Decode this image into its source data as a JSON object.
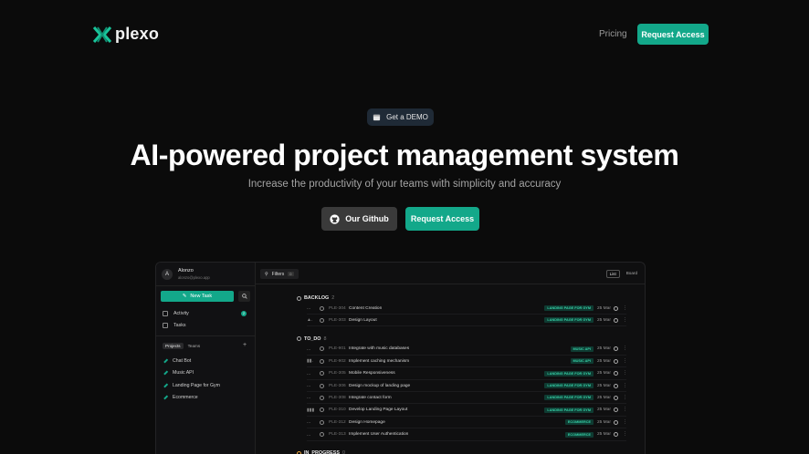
{
  "nav": {
    "brand": "plexo",
    "links": [
      "Pricing"
    ],
    "cta_label": "Request Access",
    "accent_color": "#13a88a"
  },
  "hero": {
    "demo_pill": "Get a DEMO",
    "title": "AI-powered project management system",
    "subtitle": "Increase the productivity of your teams with simplicity and accuracy",
    "github_label": "Our Github",
    "request_label": "Request Access"
  },
  "app": {
    "user": {
      "initial": "A",
      "name": "Alonzo",
      "email": "alonzo@plexo.app"
    },
    "new_task_label": "New Task",
    "nav": [
      {
        "label": "Activity",
        "badge": "2"
      },
      {
        "label": "Tasks"
      }
    ],
    "sidebar_tabs": [
      "Projects",
      "Teams"
    ],
    "projects": [
      "Chat Bot",
      "Music API",
      "Landing Page for Gym",
      "Ecommerce"
    ],
    "toolbar": {
      "filters_label": "Filters",
      "filters_count": "0",
      "view_list": "List",
      "view_board": "Board"
    },
    "groups": [
      {
        "name": "BACKLOG",
        "count": "2",
        "tasks": [
          {
            "priority": "...",
            "id": "PLE-304",
            "title": "Content Creation",
            "tag": "LANDING PAGE FOR GYM",
            "date": "25 Mar"
          },
          {
            "priority": "▲.",
            "id": "PLE-303",
            "title": "Design Layout",
            "tag": "LANDING PAGE FOR GYM",
            "date": "25 Mar"
          }
        ]
      },
      {
        "name": "TO_DO",
        "count": "8",
        "tasks": [
          {
            "priority": "...",
            "id": "PLE-901",
            "title": "Integrate with music databases",
            "tag": "MUSIC API",
            "date": "25 Mar"
          },
          {
            "priority": "▮▮.",
            "id": "PLE-902",
            "title": "Implement caching mechanism",
            "tag": "MUSIC API",
            "date": "25 Mar"
          },
          {
            "priority": "...",
            "id": "PLE-305",
            "title": "Mobile Responsiveness",
            "tag": "LANDING PAGE FOR GYM",
            "date": "25 Mar"
          },
          {
            "priority": "...",
            "id": "PLE-306",
            "title": "Design mockup of landing page",
            "tag": "LANDING PAGE FOR GYM",
            "date": "25 Mar"
          },
          {
            "priority": "...",
            "id": "PLE-308",
            "title": "Integrate contact form",
            "tag": "LANDING PAGE FOR GYM",
            "date": "25 Mar"
          },
          {
            "priority": "▮▮▮",
            "id": "PLE-310",
            "title": "Develop Landing Page Layout",
            "tag": "LANDING PAGE FOR GYM",
            "date": "25 Mar"
          },
          {
            "priority": "...",
            "id": "PLE-312",
            "title": "Design Homepage",
            "tag": "ECOMMERCE",
            "date": "25 Mar"
          },
          {
            "priority": "...",
            "id": "PLE-313",
            "title": "Implement User Authentication",
            "tag": "ECOMMERCE",
            "date": "25 Mar"
          }
        ]
      },
      {
        "name": "IN_PROGRESS",
        "count": "0",
        "tasks": []
      }
    ]
  }
}
